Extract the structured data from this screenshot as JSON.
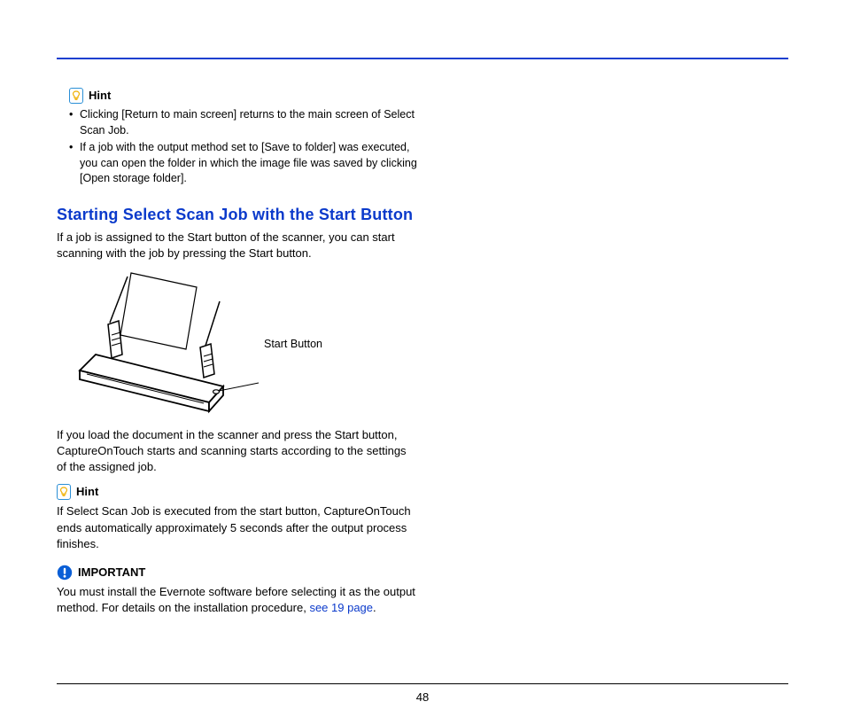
{
  "hint1": {
    "label": "Hint",
    "bullets": [
      "Clicking [Return to main screen] returns to the main screen of Select Scan Job.",
      "If a job with the output method set to [Save to folder] was executed, you can open the folder in which the image file was saved by clicking [Open storage folder]."
    ]
  },
  "section": {
    "heading": "Starting Select Scan Job with the Start Button",
    "intro": "If a job is assigned to the Start button of the scanner, you can start scanning with the job by pressing the Start button.",
    "figure_label": "Start Button",
    "after_figure": "If you load the document in the scanner and press the Start button, CaptureOnTouch starts and scanning starts according to the settings of the assigned job."
  },
  "hint2": {
    "label": "Hint",
    "text": "If Select Scan Job is executed from the start button, CaptureOnTouch ends automatically approximately 5 seconds after the output process finishes."
  },
  "important": {
    "label": "IMPORTANT",
    "text_before_link": "You must install the Evernote software before selecting it as the output method. For details on the installation procedure, ",
    "link_text": "see 19 page",
    "text_after_link": "."
  },
  "page_number": "48"
}
